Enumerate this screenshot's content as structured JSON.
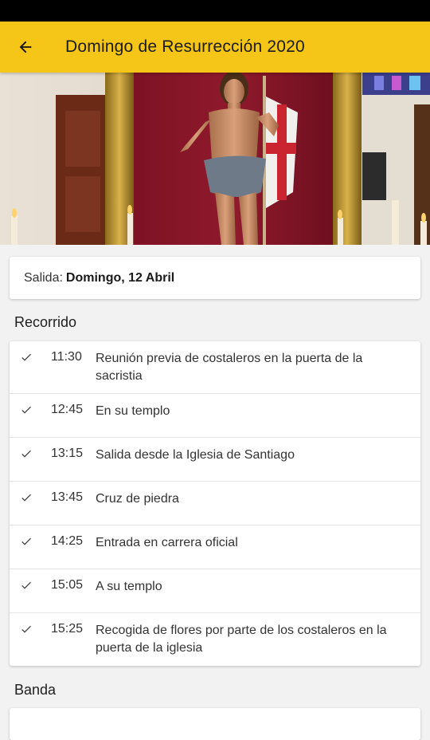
{
  "app_bar": {
    "title": "Domingo de Resurrección 2020",
    "back_icon": "arrow-back-icon",
    "color": "#f5c518"
  },
  "salida": {
    "label": "Salida:",
    "value": "Domingo, 12 Abril"
  },
  "recorrido": {
    "title": "Recorrido",
    "items": [
      {
        "time": "11:30",
        "text": "Reunión previa de costaleros en la puerta de la sacristia"
      },
      {
        "time": "12:45",
        "text": "En su templo"
      },
      {
        "time": "13:15",
        "text": "Salida desde la Iglesia de Santiago"
      },
      {
        "time": "13:45",
        "text": "Cruz de piedra"
      },
      {
        "time": "14:25",
        "text": "Entrada en carrera oficial"
      },
      {
        "time": "15:05",
        "text": "A su templo"
      },
      {
        "time": "15:25",
        "text": "Recogida de flores por parte de los costaleros en la puerta de la iglesia"
      }
    ]
  },
  "banda": {
    "title": "Banda"
  }
}
